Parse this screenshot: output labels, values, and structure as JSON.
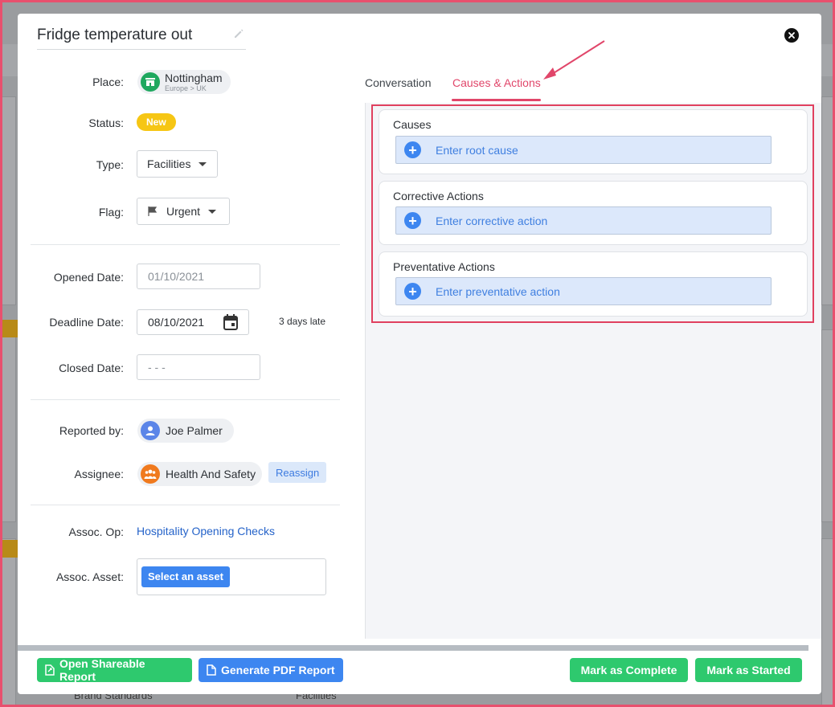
{
  "modal": {
    "title": "Fridge temperature out",
    "fields": {
      "place_label": "Place:",
      "place_name": "Nottingham",
      "place_sub": "Europe > UK",
      "status_label": "Status:",
      "status_value": "New",
      "type_label": "Type:",
      "type_value": "Facilities",
      "flag_label": "Flag:",
      "flag_value": "Urgent",
      "opened_label": "Opened Date:",
      "opened_value": "01/10/2021",
      "deadline_label": "Deadline Date:",
      "deadline_value": "08/10/2021",
      "late_text": "3 days late",
      "closed_label": "Closed Date:",
      "closed_placeholder": "- - -",
      "reported_label": "Reported by:",
      "reported_value": "Joe Palmer",
      "assignee_label": "Assignee:",
      "assignee_value": "Health And Safety",
      "reassign_label": "Reassign",
      "assoc_op_label": "Assoc. Op:",
      "assoc_op_value": "Hospitality Opening Checks",
      "assoc_asset_label": "Assoc. Asset:",
      "assoc_asset_button": "Select an asset"
    },
    "tabs": [
      {
        "label": "Conversation",
        "active": false
      },
      {
        "label": "Causes & Actions",
        "active": true
      }
    ],
    "sections": [
      {
        "title": "Causes",
        "entry": "Enter root cause"
      },
      {
        "title": "Corrective Actions",
        "entry": "Enter corrective action"
      },
      {
        "title": "Preventative Actions",
        "entry": "Enter preventative action"
      }
    ],
    "footer": {
      "open_report": "Open Shareable Report",
      "generate_pdf": "Generate PDF Report",
      "mark_complete": "Mark as Complete",
      "mark_started": "Mark as Started"
    }
  },
  "background": {
    "card_labels": [
      "Brand Standards",
      "Facilities"
    ]
  },
  "colors": {
    "accent": "#e1466a",
    "primary_blue": "#3d86f0",
    "success_green": "#2ec96e",
    "status_yellow": "#f6c614"
  }
}
